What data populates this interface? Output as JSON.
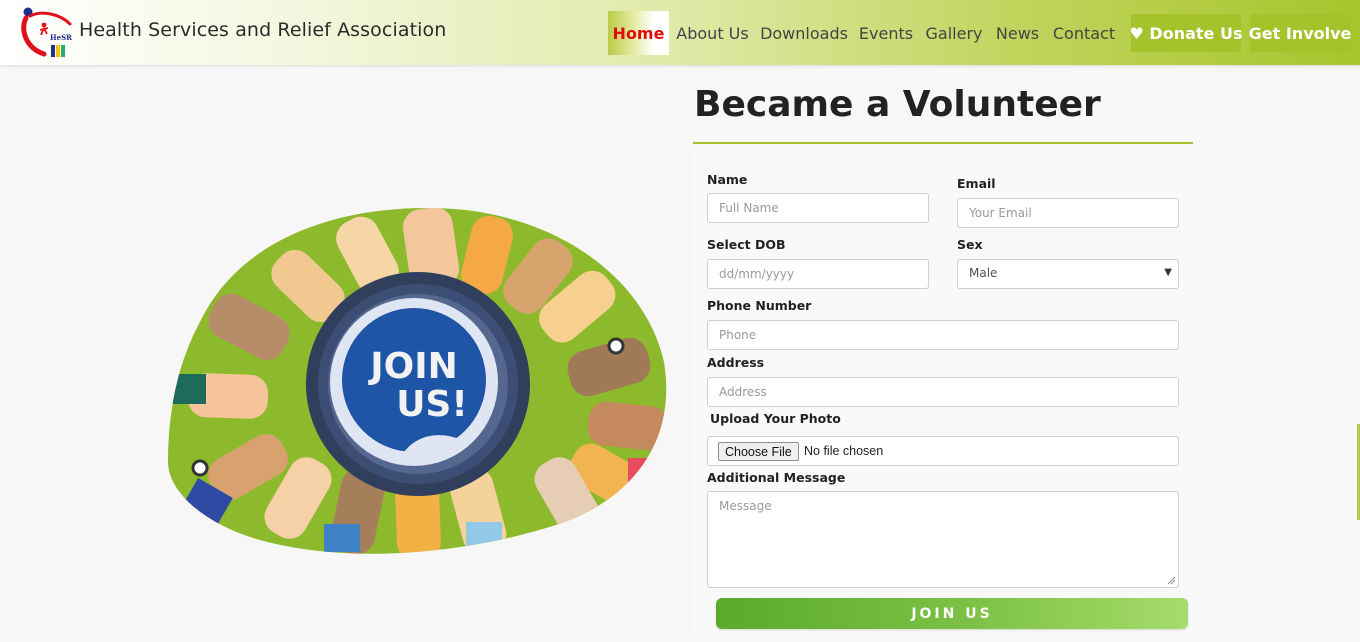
{
  "header": {
    "logo_text": "HeSRA",
    "brand": "Health Services and Relief Association",
    "nav": [
      "Home",
      "About Us",
      "Downloads",
      "Events",
      "Gallery",
      "News",
      "Contact"
    ],
    "donate_icon": "heart-icon",
    "donate_label": "♥ Donate Us",
    "involve_label": "Get Involve"
  },
  "hero": {
    "badge_text": [
      "JOIN",
      "US!"
    ]
  },
  "form": {
    "title": "Became a Volunteer",
    "name_label": "Name",
    "name_placeholder": "Full Name",
    "email_label": "Email",
    "email_placeholder": "Your Email",
    "dob_label": "Select DOB",
    "dob_placeholder": "dd/mm/yyyy",
    "sex_label": "Sex",
    "sex_value": "Male",
    "phone_label": "Phone Number",
    "phone_placeholder": "Phone",
    "address_label": "Address",
    "address_placeholder": "Address",
    "photo_label": "Upload Your Photo",
    "file_button": "Choose File",
    "file_status": "No file chosen",
    "message_label": "Additional Message",
    "message_placeholder": "Message",
    "submit_label": "JOIN  US"
  },
  "colors": {
    "accent": "#a5c22a",
    "active_nav": "#e30a0a",
    "submit_start": "#5aaa2c",
    "submit_end": "#a6dc6a"
  }
}
